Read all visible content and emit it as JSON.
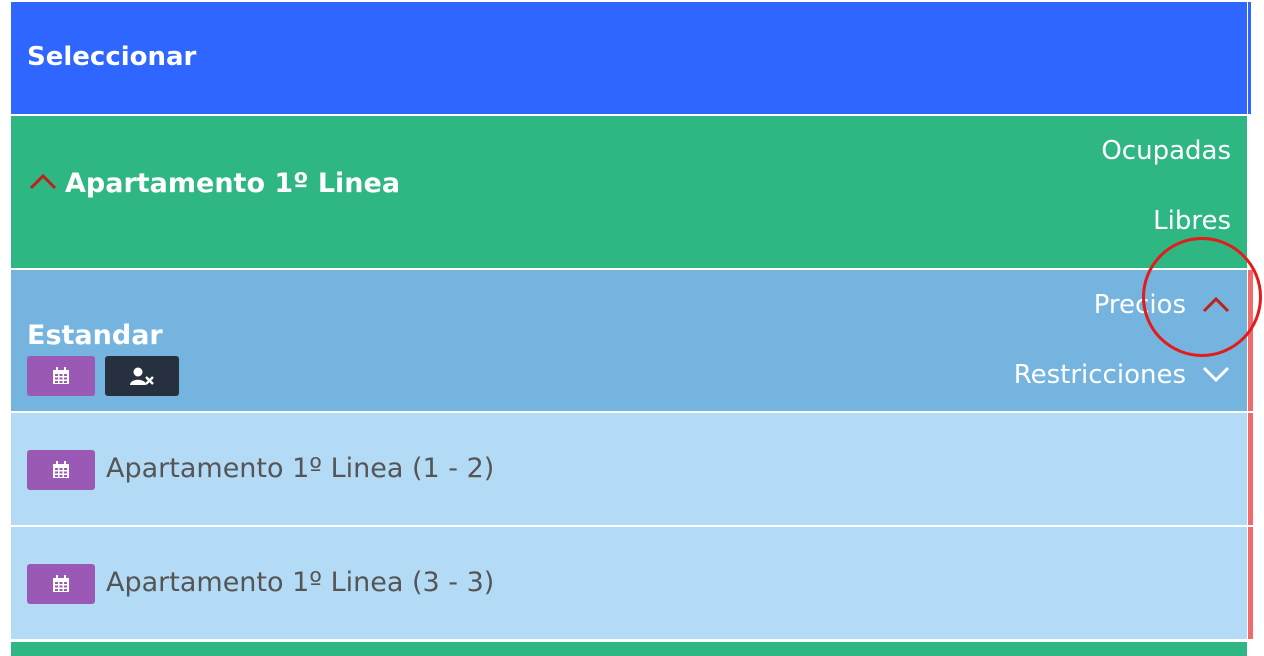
{
  "header": {
    "title": "Seleccionar"
  },
  "group": {
    "title": "Apartamento 1º Linea",
    "ocupadas_label": "Ocupadas",
    "libres_label": "Libres"
  },
  "room": {
    "title": "Estandar",
    "precios_label": "Precios",
    "restricciones_label": "Restricciones"
  },
  "units": [
    {
      "label": "Apartamento 1º Linea (1 - 2)"
    },
    {
      "label": "Apartamento 1º Linea (3 - 3)"
    }
  ],
  "colors": {
    "header_bg": "#2f66ff",
    "group_bg": "#2fb783",
    "room_bg": "#74b4de",
    "unit_bg": "#b4dbf5",
    "calendar_button": "#9b59b6",
    "user_button": "#26303e",
    "accent_red": "#e41b1b"
  }
}
